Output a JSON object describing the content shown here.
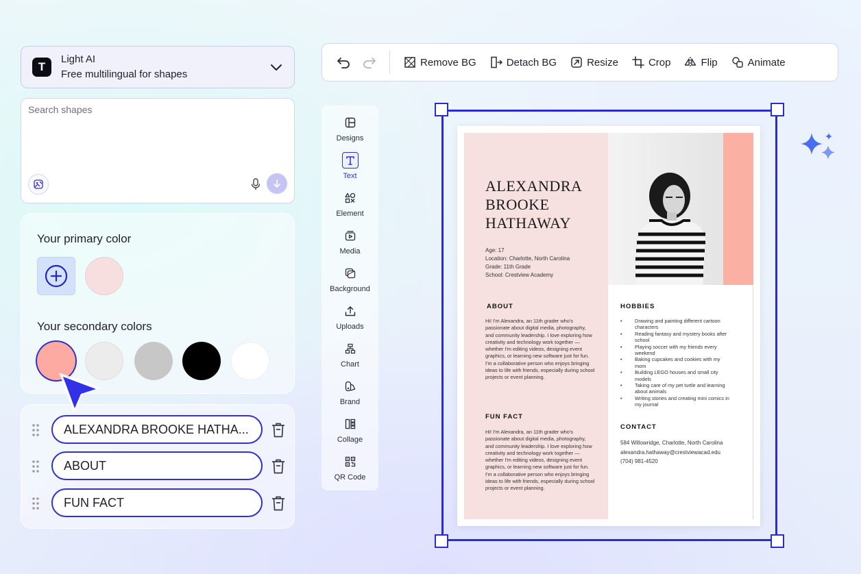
{
  "model_selector": {
    "name": "Light AI",
    "description": "Free multilingual for shapes",
    "logo_letter": "T"
  },
  "search": {
    "placeholder": "Search shapes"
  },
  "colors": {
    "primary_title": "Your primary color",
    "secondary_title": "Your secondary colors",
    "primary_swatch": "#f7dfdf",
    "secondary_swatches": [
      "#fdaaa3",
      "#ececec",
      "#c7c7c7",
      "#000000",
      "#ffffff"
    ],
    "accent": "#3131c8"
  },
  "layers": [
    {
      "label": "ALEXANDRA BROOKE HATHA..."
    },
    {
      "label": "ABOUT"
    },
    {
      "label": "FUN FACT"
    }
  ],
  "toolbar": {
    "remove_bg": "Remove BG",
    "detach_bg": "Detach BG",
    "resize": "Resize",
    "crop": "Crop",
    "flip": "Flip",
    "animate": "Animate"
  },
  "rail": {
    "designs": "Designs",
    "text": "Text",
    "element": "Element",
    "media": "Media",
    "background": "Background",
    "uploads": "Uploads",
    "chart": "Chart",
    "brand": "Brand",
    "collage": "Collage",
    "qr_code": "QR Code"
  },
  "resume": {
    "name_line1": "ALEXANDRA",
    "name_line2": "BROOKE",
    "name_line3": "HATHAWAY",
    "age": "Age: 17",
    "location": "Location: Charlotte, North Carolina",
    "grade": "Grade: 11th Grade",
    "school": "School: Crestview Academy",
    "about_heading": "ABOUT",
    "about_text": "Hi! I'm Alexandra, an 11th grader who's passionate about digital media, photography, and community leadership. I love exploring how creativity and technology work together — whether I'm editing videos, designing event graphics, or learning new software just for fun. I'm a collaborative person who enjoys bringing ideas to life with friends, especially during school projects or event planning.",
    "funfact_heading": "FUN FACT",
    "funfact_text": "Hi! I'm Alexandra, an 11th grader who's passionate about digital media, photography, and community leadership. I love exploring how creativity and technology work together — whether I'm editing videos, designing event graphics, or learning new software just for fun. I'm a collaborative person who enjoys bringing ideas to life with friends, especially during school projects or event planning.",
    "hobbies_heading": "HOBBIES",
    "hobbies": [
      "Drawing and painting different cartoon characters",
      "Reading fantasy and mystery books after school",
      "Playing soccer with my friends every weekend",
      "Baking cupcakes and cookies with my mom",
      "Building LEGO houses and small city models",
      "Taking care of my pet turtle and learning about animals",
      "Writing stories and creating mini comics in my journal"
    ],
    "contact_heading": "CONTACT",
    "address": "584 Willowridge, Charlotte, North Carolina",
    "email": "alexandra.hathaway@crestviewacad.edu",
    "phone": "(704) 981-4520"
  }
}
